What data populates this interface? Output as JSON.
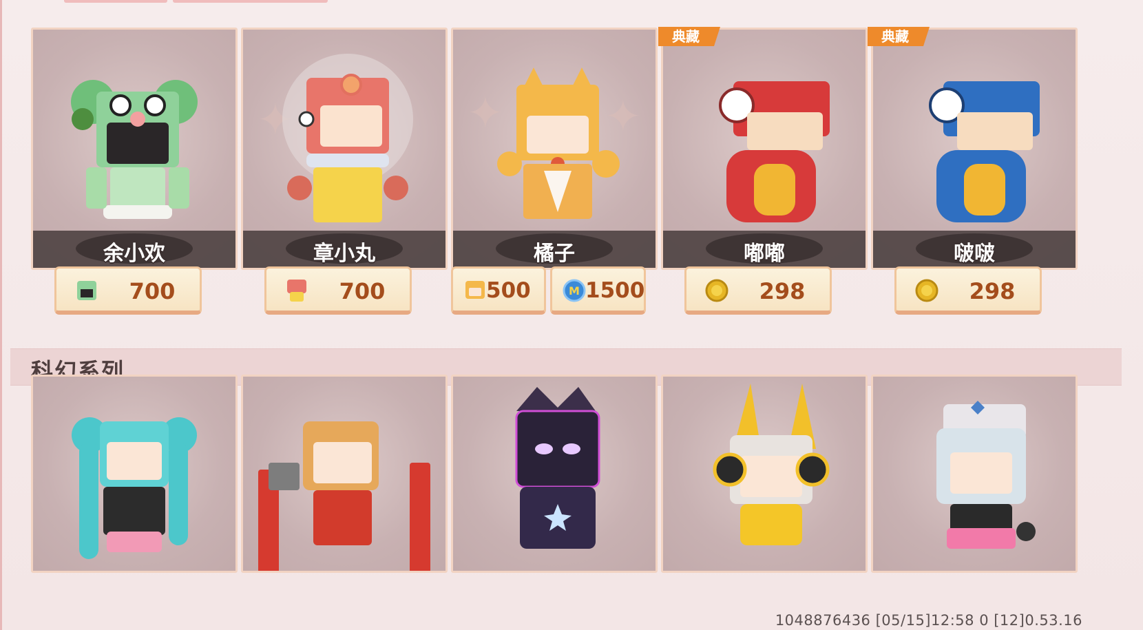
{
  "skins_row1": [
    {
      "name": "余小欢",
      "price": "700",
      "currency_icon": "skin-fragment-green-icon"
    },
    {
      "name": "章小丸",
      "price": "700",
      "currency_icon": "skin-fragment-orange-icon"
    },
    {
      "name": "橘子",
      "prices": [
        {
          "value": "500",
          "currency_icon": "skin-fragment-tiger-icon"
        },
        {
          "value": "1500",
          "currency_icon": "mini-coin-blue-icon"
        }
      ]
    },
    {
      "name": "嘟嘟",
      "badge": "典藏",
      "price": "298",
      "currency_icon": "gold-coin-icon"
    },
    {
      "name": "啵啵",
      "badge": "典藏",
      "price": "298",
      "currency_icon": "gold-coin-icon"
    }
  ],
  "section": {
    "title": "科幻系列"
  },
  "footer": {
    "text": "1048876436   [05/15]12:58 0   [12]0.53.16"
  },
  "colors": {
    "price_text": "#a44d1c",
    "badge": "#ee8a2b",
    "card_bg": "#c9b3b4"
  }
}
